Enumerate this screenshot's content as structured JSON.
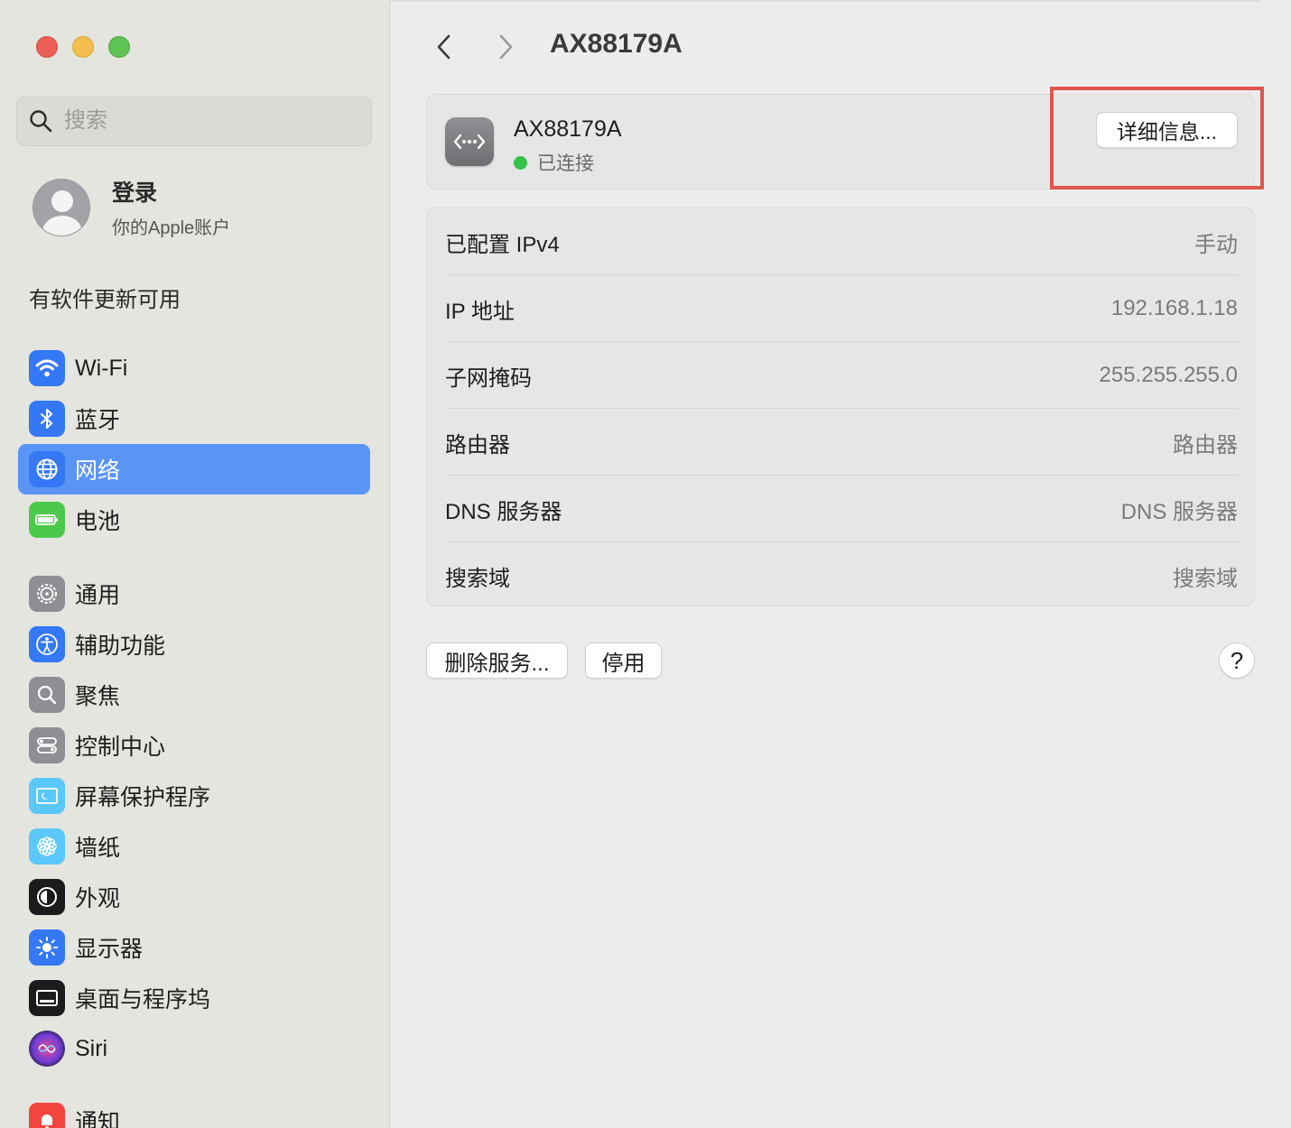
{
  "window": {
    "controls": [
      "close",
      "minimize",
      "zoom"
    ]
  },
  "sidebar": {
    "search_placeholder": "搜索",
    "account": {
      "title": "登录",
      "subtitle": "你的Apple账户"
    },
    "update_notice": "有软件更新可用",
    "items": [
      {
        "label": "Wi-Fi",
        "icon": "wifi-icon",
        "color": "#3478f6",
        "active": false
      },
      {
        "label": "蓝牙",
        "icon": "bluetooth-icon",
        "color": "#3478f6",
        "active": false
      },
      {
        "label": "网络",
        "icon": "globe-icon",
        "color": "#3478f6",
        "active": true
      },
      {
        "label": "电池",
        "icon": "battery-icon",
        "color": "#4cc94b",
        "active": false
      },
      {
        "label": "通用",
        "icon": "gear-icon",
        "color": "#8e8e93",
        "active": false
      },
      {
        "label": "辅助功能",
        "icon": "accessibility-icon",
        "color": "#3478f6",
        "active": false
      },
      {
        "label": "聚焦",
        "icon": "spotlight-icon",
        "color": "#8e8e93",
        "active": false
      },
      {
        "label": "控制中心",
        "icon": "control-center-icon",
        "color": "#8e8e93",
        "active": false
      },
      {
        "label": "屏幕保护程序",
        "icon": "screensaver-icon",
        "color": "#5ac8fa",
        "active": false
      },
      {
        "label": "墙纸",
        "icon": "wallpaper-icon",
        "color": "#5ac8fa",
        "active": false
      },
      {
        "label": "外观",
        "icon": "appearance-icon",
        "color": "#1c1c1e",
        "active": false
      },
      {
        "label": "显示器",
        "icon": "display-icon",
        "color": "#3478f6",
        "active": false
      },
      {
        "label": "桌面与程序坞",
        "icon": "dock-icon",
        "color": "#1c1c1e",
        "active": false
      },
      {
        "label": "Siri",
        "icon": "siri-icon",
        "color": "#6e3bd6",
        "active": false
      },
      {
        "label": "通知",
        "icon": "notifications-icon",
        "color": "#f2453d",
        "active": false
      }
    ]
  },
  "main": {
    "title": "AX88179A",
    "device": {
      "name": "AX88179A",
      "status": "已连接",
      "status_color": "#35c24a",
      "details_button": "详细信息..."
    },
    "rows": [
      {
        "label": "已配置 IPv4",
        "value": "手动"
      },
      {
        "label": "IP 地址",
        "value": "192.168.1.18"
      },
      {
        "label": "子网掩码",
        "value": "255.255.255.0"
      },
      {
        "label": "路由器",
        "value": "路由器"
      },
      {
        "label": "DNS 服务器",
        "value": "DNS 服务器"
      },
      {
        "label": "搜索域",
        "value": "搜索域"
      }
    ],
    "buttons": {
      "delete_service": "删除服务...",
      "disable": "停用",
      "help": "?"
    },
    "highlight_color": "#e0554c"
  }
}
